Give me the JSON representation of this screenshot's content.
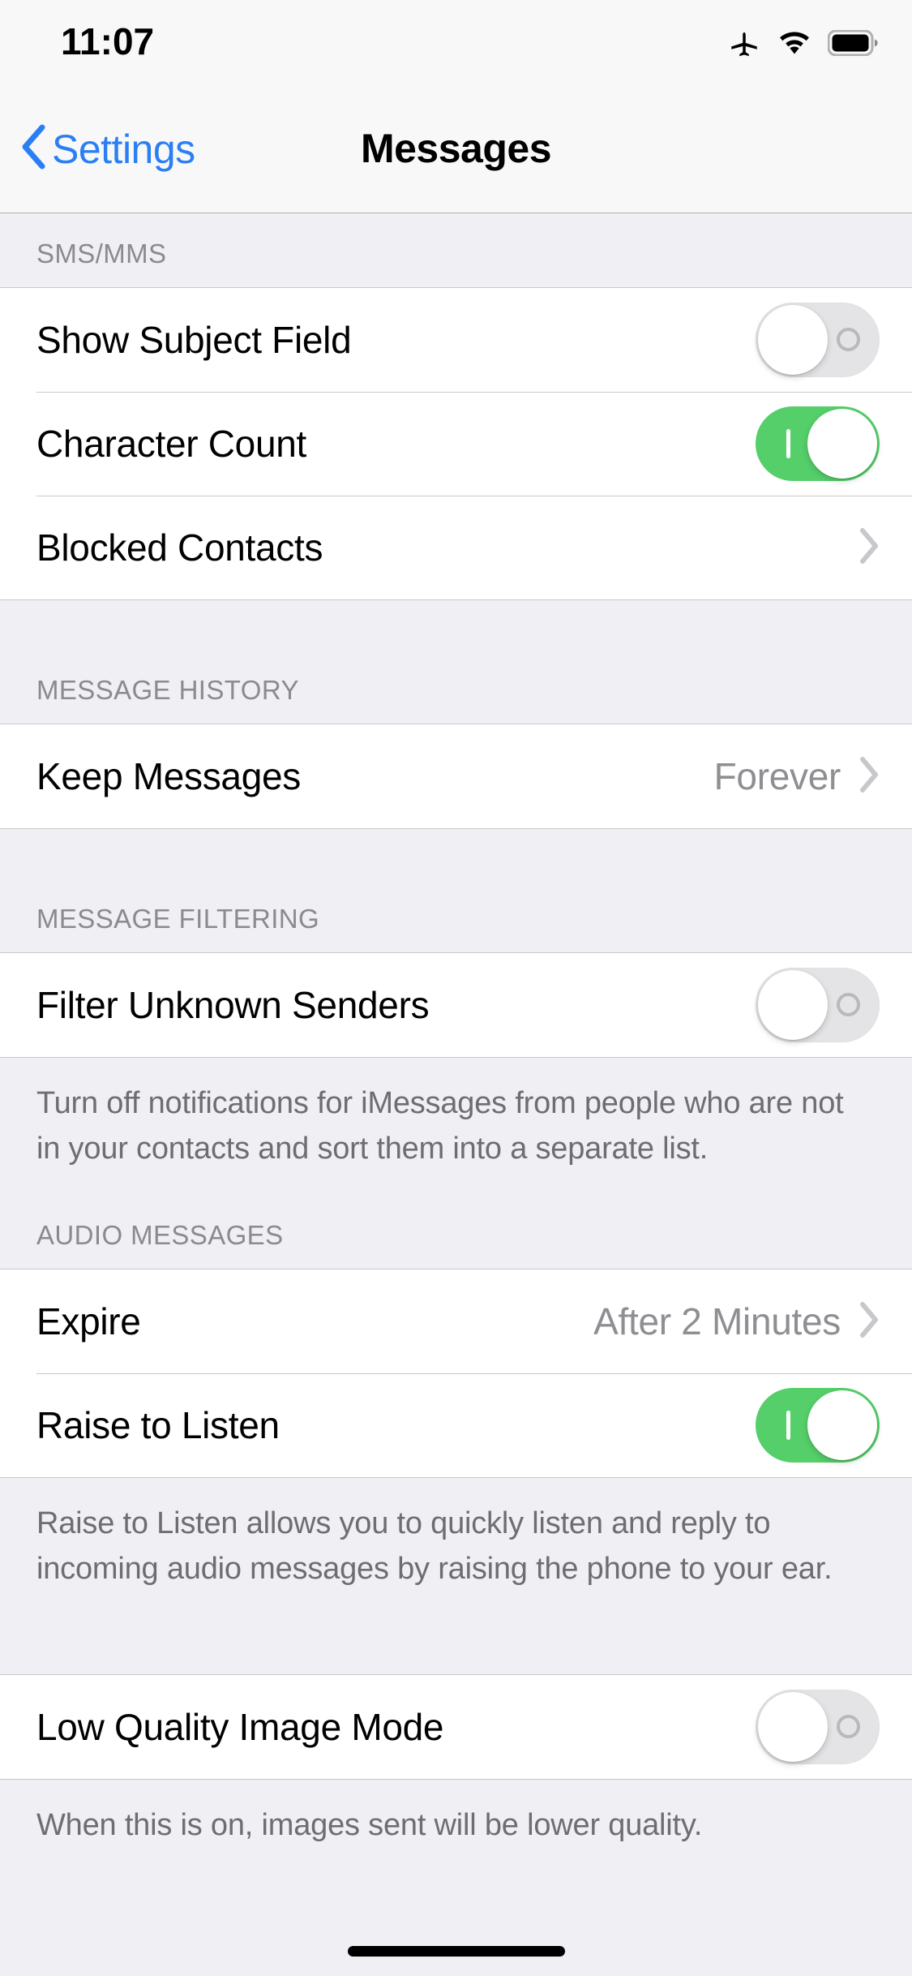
{
  "status_bar": {
    "time": "11:07",
    "icons": [
      "airplane-mode-icon",
      "wifi-icon",
      "battery-icon"
    ]
  },
  "nav": {
    "back_label": "Settings",
    "title": "Messages",
    "back_icon": "chevron-left-icon",
    "accent_color": "#2b7ff5"
  },
  "sections": [
    {
      "header": "SMS/MMS",
      "rows": [
        {
          "label": "Show Subject Field",
          "control": "switch",
          "on": false
        },
        {
          "label": "Character Count",
          "control": "switch",
          "on": true
        },
        {
          "label": "Blocked Contacts",
          "control": "chevron"
        }
      ],
      "footer": ""
    },
    {
      "header": "MESSAGE HISTORY",
      "rows": [
        {
          "label": "Keep Messages",
          "control": "chevron",
          "value": "Forever"
        }
      ],
      "footer": ""
    },
    {
      "header": "MESSAGE FILTERING",
      "rows": [
        {
          "label": "Filter Unknown Senders",
          "control": "switch",
          "on": false
        }
      ],
      "footer": "Turn off notifications for iMessages from people who are not in your contacts and sort them into a separate list."
    },
    {
      "header": "AUDIO MESSAGES",
      "rows": [
        {
          "label": "Expire",
          "control": "chevron",
          "value": "After 2 Minutes"
        },
        {
          "label": "Raise to Listen",
          "control": "switch",
          "on": true
        }
      ],
      "footer": "Raise to Listen allows you to quickly listen and reply to incoming audio messages by raising the phone to your ear."
    },
    {
      "header": "",
      "rows": [
        {
          "label": "Low Quality Image Mode",
          "control": "switch",
          "on": false
        }
      ],
      "footer": "When this is on, images sent will be lower quality."
    }
  ],
  "colors": {
    "switch_on": "#55cf6a",
    "switch_off": "#e4e4e6",
    "chevron": "#c7c7cc",
    "group_bg": "#efeff4",
    "row_bg": "#ffffff",
    "separator": "#c8c7cc",
    "secondary_text": "#8e8e93"
  }
}
